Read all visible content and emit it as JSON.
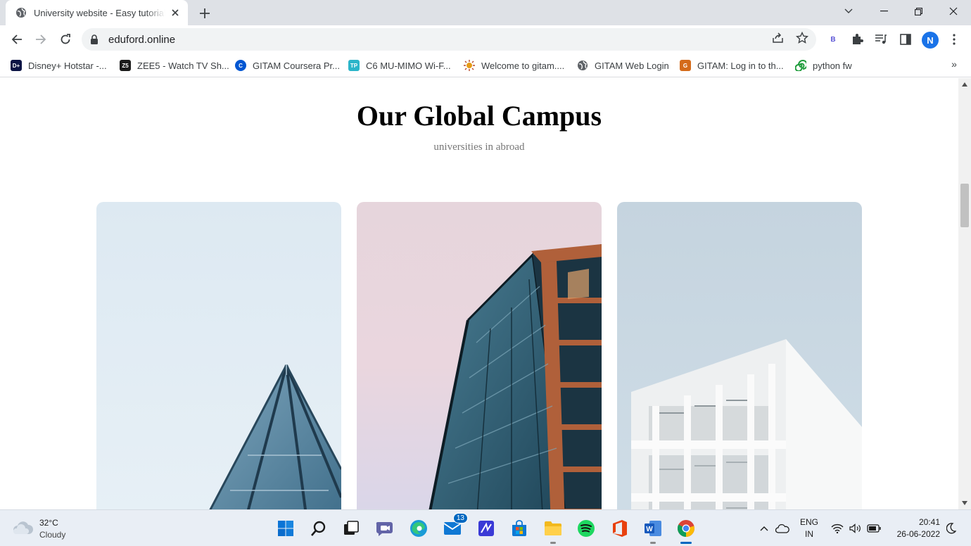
{
  "browser": {
    "tab_title": "University website - Easy tutorials",
    "url": "eduford.online",
    "profile_initial": "N",
    "extension_label": "B"
  },
  "bookmarks": [
    {
      "label": "Disney+ Hotstar -...",
      "icon": "hotstar-icon",
      "icon_text": "D+",
      "color": "#0c1445"
    },
    {
      "label": "ZEE5 - Watch TV Sh...",
      "icon": "zee5-icon",
      "icon_text": "Z5",
      "color": "#1b1b1b"
    },
    {
      "label": "GITAM Coursera Pr...",
      "icon": "coursera-icon",
      "icon_text": "C",
      "color": "#0056d2"
    },
    {
      "label": "C6 MU-MIMO Wi-F...",
      "icon": "router-icon",
      "icon_text": "TP",
      "color": "#2bb5c9"
    },
    {
      "label": "Welcome to gitam....",
      "icon": "sun-icon",
      "icon_text": "",
      "color": "#e69a17"
    },
    {
      "label": "GITAM Web Login",
      "icon": "globe-icon",
      "icon_text": "",
      "color": "#5f6368"
    },
    {
      "label": "GITAM: Log in to th...",
      "icon": "gitam-icon",
      "icon_text": "G",
      "color": "#d46b1a"
    },
    {
      "label": "python fw",
      "icon": "spiral-icon",
      "icon_text": "",
      "color": "#1e9c3b"
    }
  ],
  "page": {
    "heading": "Our Global Campus",
    "subheading": "universities in abroad",
    "cards": [
      {
        "name": "campus-card-1",
        "subject": "glass pyramid building"
      },
      {
        "name": "campus-card-2",
        "subject": "glass and copper tower"
      },
      {
        "name": "campus-card-3",
        "subject": "white modern building"
      }
    ]
  },
  "taskbar": {
    "weather_temp": "32°C",
    "weather_desc": "Cloudy",
    "mail_badge": "13",
    "lang_top": "ENG",
    "lang_bottom": "IN",
    "time": "20:41",
    "date": "26-06-2022"
  },
  "colors": {
    "accent": "#1a73e8",
    "taskbar_active": "#0067c0"
  }
}
